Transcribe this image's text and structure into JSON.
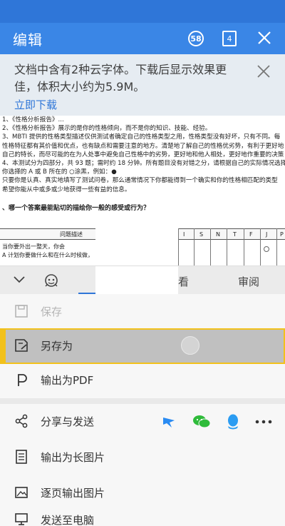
{
  "header": {
    "title": "编辑",
    "badge_count": "58",
    "tab_count": "4"
  },
  "banner": {
    "message": "文档中含有2种云字体。下载后显示效果更佳，体积大小约为5.9M。",
    "action": "立即下载"
  },
  "document": {
    "lines": [
      "1、《性格分析报告》...",
      "2、《性格分析报告》展示的是你的性格倾向，而不是你的知识、技能、经验。",
      "3、MBTI 提供的性格类型描述仅供测试者确定自己的性格类型之用，性格类型没有好坏，只有不同。每",
      "性格特征都有其价值和优点，也有缺点和需要注意的地方。清楚地了解自己的性格优劣势，有利于更好地",
      "自己的特长，而尽可能的在为人处事中避免自己性格中的劣势，更好地和他人相处，更好地作重要的决策",
      "4、本测试分为四部分，共 93 题；需时约 18 分钟。所有题目没有对错之分，请根据自己的实际情况选择",
      "你选择的 A 或 B 所在的 ○涂黑，例如：●",
      "只要你是认真、真实地填写了测试问卷，那么通常情况下你都能得到一个确实和你的性格相匹配的类型",
      "希望你能从中或多或少地获得一些有益的信息。"
    ],
    "question": "、哪一个答案最能贴切的描绘你一般的感受或行为？",
    "table_header": "问题描述",
    "table_columns": [
      "I",
      "S",
      "N",
      "T",
      "F",
      "J",
      "P"
    ],
    "table_rows": [
      "当你要外出一整天，你会",
      "A 计划你要做什么和在什么时候做，"
    ]
  },
  "sheet": {
    "tabs": [
      "看",
      "审阅"
    ],
    "items": [
      {
        "label": "保存",
        "icon": "save-icon",
        "disabled": true
      },
      {
        "label": "另存为",
        "icon": "save-as-icon",
        "selected": true
      },
      {
        "label": "输出为PDF",
        "icon": "pdf-icon"
      },
      {
        "label": "分享与发送",
        "icon": "share-icon"
      },
      {
        "label": "输出为长图片",
        "icon": "long-image-icon"
      },
      {
        "label": "逐页输出图片",
        "icon": "page-image-icon"
      },
      {
        "label": "发送至电脑",
        "icon": "computer-icon"
      }
    ],
    "share_apps": [
      "dingtalk-icon",
      "wechat-icon",
      "qq-icon",
      "more-icon"
    ]
  },
  "colors": {
    "header_blue": "#3a86e6",
    "highlight_yellow": "#f2c11b",
    "link_blue": "#2f76d8"
  }
}
